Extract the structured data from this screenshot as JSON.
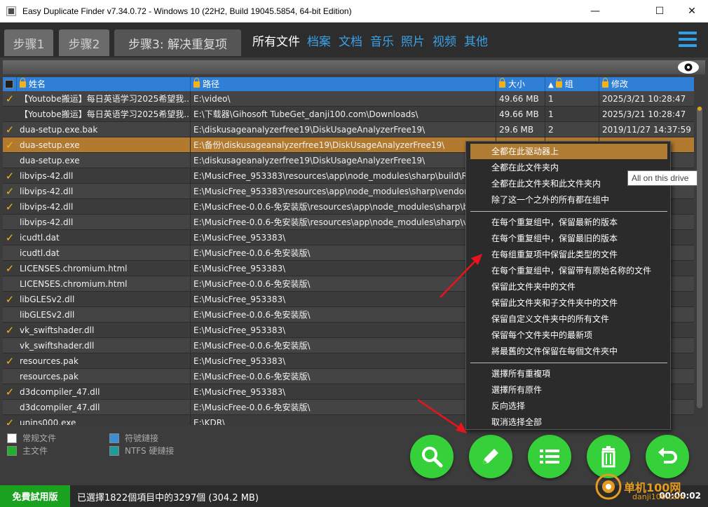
{
  "window": {
    "title": "Easy Duplicate Finder v7.34.0.72 - Windows 10 (22H2, Build 19045.5854, 64-bit Edition)",
    "minimize": "—",
    "maximize": "☐",
    "close": "✕"
  },
  "steps": [
    {
      "label": "步骤1"
    },
    {
      "label": "步骤2"
    },
    {
      "label": "步骤3: 解决重复项"
    }
  ],
  "categories": [
    {
      "label": "所有文件",
      "active": true
    },
    {
      "label": "档案"
    },
    {
      "label": "文档"
    },
    {
      "label": "音乐"
    },
    {
      "label": "照片"
    },
    {
      "label": "视频"
    },
    {
      "label": "其他"
    }
  ],
  "table": {
    "columns": [
      {
        "label": "姓名"
      },
      {
        "label": "路径"
      },
      {
        "label": "大小"
      },
      {
        "label": "组",
        "sort": "▲"
      },
      {
        "label": "修改"
      }
    ],
    "rows": [
      {
        "checked": true,
        "name": "【Youtobe搬运】每日英语学习2025希望我...",
        "path": "E:\\video\\",
        "size": "49.66 MB",
        "group": "1",
        "modified": "2025/3/21 10:28:47"
      },
      {
        "checked": false,
        "name": "【Youtobe搬运】每日英语学习2025希望我...",
        "path": "E:\\下载器\\Gihosoft TubeGet_danji100.com\\Downloads\\",
        "size": "49.66 MB",
        "group": "1",
        "modified": "2025/3/21 10:28:47"
      },
      {
        "checked": true,
        "name": "dua-setup.exe.bak",
        "path": "E:\\diskusageanalyzerfree19\\DiskUsageAnalyzerFree19\\",
        "size": "29.6 MB",
        "group": "2",
        "modified": "2019/11/27 14:37:59"
      },
      {
        "checked": true,
        "name": "dua-setup.exe",
        "path": "E:\\备份\\diskusageanalyzerfree19\\DiskUsageAnalyzerFree19\\",
        "size": "",
        "group": "",
        "modified": "59",
        "selected": true
      },
      {
        "checked": false,
        "name": "dua-setup.exe",
        "path": "E:\\diskusageanalyzerfree19\\DiskUsageAnalyzerFree19\\",
        "size": "",
        "group": "",
        "modified": "04"
      },
      {
        "checked": true,
        "name": "libvips-42.dll",
        "path": "E:\\MusicFree_953383\\resources\\app\\node_modules\\sharp\\build\\Release\\",
        "size": "",
        "group": "",
        "modified": ""
      },
      {
        "checked": true,
        "name": "libvips-42.dll",
        "path": "E:\\MusicFree_953383\\resources\\app\\node_modules\\sharp\\vendor\\8.14.5",
        "size": "",
        "group": "",
        "modified": ""
      },
      {
        "checked": true,
        "name": "libvips-42.dll",
        "path": "E:\\MusicFree-0.0.6-免安装版\\resources\\app\\node_modules\\sharp\\build\\R",
        "size": "",
        "group": "",
        "modified": "10"
      },
      {
        "checked": false,
        "name": "libvips-42.dll",
        "path": "E:\\MusicFree-0.0.6-免安装版\\resources\\app\\node_modules\\sharp\\vendor",
        "size": "",
        "group": "",
        "modified": "10"
      },
      {
        "checked": true,
        "name": "icudtl.dat",
        "path": "E:\\MusicFree_953383\\",
        "size": "",
        "group": "",
        "modified": "10"
      },
      {
        "checked": false,
        "name": "icudtl.dat",
        "path": "E:\\MusicFree-0.0.6-免安装版\\",
        "size": "",
        "group": "",
        "modified": "08"
      },
      {
        "checked": true,
        "name": "LICENSES.chromium.html",
        "path": "E:\\MusicFree_953383\\",
        "size": "",
        "group": "",
        "modified": "10"
      },
      {
        "checked": false,
        "name": "LICENSES.chromium.html",
        "path": "E:\\MusicFree-0.0.6-免安装版\\",
        "size": "",
        "group": "",
        "modified": "08"
      },
      {
        "checked": true,
        "name": "libGLESv2.dll",
        "path": "E:\\MusicFree_953383\\",
        "size": "",
        "group": "",
        "modified": "10"
      },
      {
        "checked": false,
        "name": "libGLESv2.dll",
        "path": "E:\\MusicFree-0.0.6-免安装版\\",
        "size": "",
        "group": "",
        "modified": "08"
      },
      {
        "checked": true,
        "name": "vk_swiftshader.dll",
        "path": "E:\\MusicFree_953383\\",
        "size": "",
        "group": "",
        "modified": "22"
      },
      {
        "checked": false,
        "name": "vk_swiftshader.dll",
        "path": "E:\\MusicFree-0.0.6-免安装版\\",
        "size": "",
        "group": "",
        "modified": "10"
      },
      {
        "checked": true,
        "name": "resources.pak",
        "path": "E:\\MusicFree_953383\\",
        "size": "",
        "group": "",
        "modified": "22"
      },
      {
        "checked": false,
        "name": "resources.pak",
        "path": "E:\\MusicFree-0.0.6-免安装版\\",
        "size": "",
        "group": "",
        "modified": "10"
      },
      {
        "checked": true,
        "name": "d3dcompiler_47.dll",
        "path": "E:\\MusicFree_953383\\",
        "size": "",
        "group": "",
        "modified": "22"
      },
      {
        "checked": false,
        "name": "d3dcompiler_47.dll",
        "path": "E:\\MusicFree-0.0.6-免安装版\\",
        "size": "",
        "group": "",
        "modified": "08"
      },
      {
        "checked": true,
        "name": "unins000.exe",
        "path": "E:\\KDR\\",
        "size": "",
        "group": "",
        "modified": "28"
      }
    ]
  },
  "legend": [
    {
      "label": "常规文件",
      "color": "#ffffff"
    },
    {
      "label": "主文件",
      "color": "#1eb12a"
    },
    {
      "label": "符號鏈接",
      "color": "#3a8fd6"
    },
    {
      "label": "NTFS 硬鏈接",
      "color": "#1c9c9c"
    }
  ],
  "actions": [
    {
      "icon": "magnifier-icon",
      "name": "search-button"
    },
    {
      "icon": "pencil-icon",
      "name": "edit-button"
    },
    {
      "icon": "list-icon",
      "name": "list-button"
    },
    {
      "icon": "trash-icon",
      "name": "delete-button"
    },
    {
      "icon": "undo-icon",
      "name": "undo-button"
    }
  ],
  "status": {
    "trial": "免費試用版",
    "text": "已選擇1822個項目中的3297個 (304.2 MB)",
    "timer": "00:00:02"
  },
  "context_menu": {
    "groups": [
      [
        "全都在此驱动器上",
        "全都在此文件夹内",
        "全都在此文件夹和此文件夹内",
        "除了这一个之外的所有都在组中"
      ],
      [
        "在每个重复组中，保留最新的版本",
        "在每个重复组中，保留最旧的版本",
        "在每组重复项中保留此类型的文件",
        "在每个重复组中，保留带有原始名称的文件",
        "保留此文件夹中的文件",
        "保留此文件夹和子文件夹中的文件",
        "保留自定义文件夹中的所有文件",
        "保留每个文件夹中的最新项",
        "將最舊的文件保留在每個文件夾中"
      ],
      [
        "選擇所有重複項",
        "選擇所有原件",
        "反向选择",
        "取消选择全部"
      ]
    ],
    "highlighted": "全都在此驱动器上"
  },
  "tooltip": "All on this drive",
  "watermark": {
    "text": "单机100网",
    "url": "danji100.com"
  },
  "colors": {
    "accent": "#2f7fd6",
    "selection": "#b27a2f",
    "action": "#35d03a",
    "check": "#f6b21a",
    "arrow": "#e8141b"
  }
}
